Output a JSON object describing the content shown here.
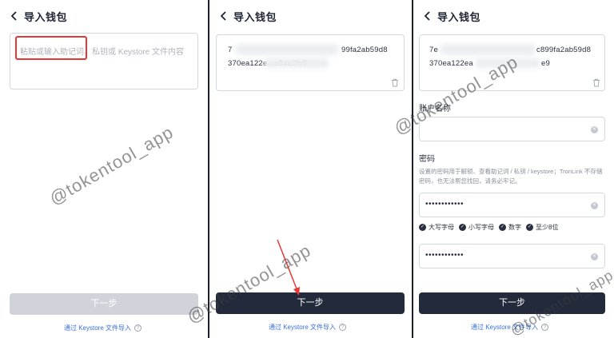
{
  "common": {
    "title": "导入钱包",
    "next_label": "下一步",
    "keystore_link": "通过 Keystore 文件导入",
    "help_glyph": "?",
    "watermark": "@tokentool_app"
  },
  "panel1": {
    "placeholder_highlighted": "粘贴或输入助记词、",
    "placeholder_rest": "私钥或 Keystore 文件内容"
  },
  "panel2": {
    "key_line1_start": "7",
    "key_line1_end": "99fa2ab59d8",
    "key_line2": "370ea122e...e8de0fe9"
  },
  "panel3": {
    "key_line1_start": "7e",
    "key_line1_end": "c899fa2ab59d8",
    "key_line2_start": "370ea122ea",
    "key_line2_end": "e9",
    "account_name_label": "账户名称",
    "password_label": "密码",
    "password_help": "设置的密码用于解锁、查看助记词 / 私钥 / keystore；TronLink 不存储密码，也无法帮您找回，请务必牢记。",
    "password_value": "••••••••••••",
    "confirm_value": "••••••••••••",
    "checks": [
      {
        "label": "大写字母"
      },
      {
        "label": "小写字母"
      },
      {
        "label": "数字"
      },
      {
        "label": "至少8位"
      }
    ]
  },
  "colors": {
    "primary_button": "#222a3c",
    "disabled_button": "#d0d4da",
    "link": "#3a6fd8",
    "highlight": "#e53935",
    "arrow": "#e53935"
  },
  "icons": {
    "back": "chevron-left-icon",
    "trash": "trash-icon",
    "clear": "clear-icon",
    "check": "check-circle-icon",
    "help": "help-circle-icon"
  }
}
